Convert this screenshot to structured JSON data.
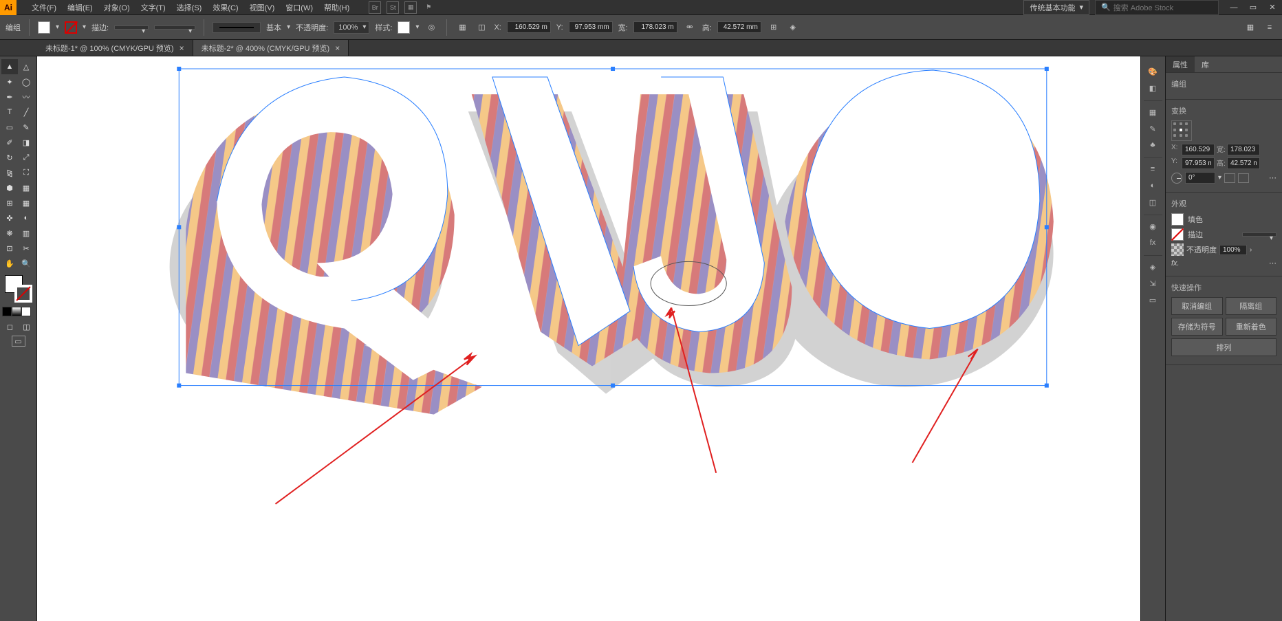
{
  "app": {
    "logo": "Ai"
  },
  "menu": {
    "file": "文件(F)",
    "edit": "编辑(E)",
    "object": "对象(O)",
    "type": "文字(T)",
    "select": "选择(S)",
    "effect": "效果(C)",
    "view": "视图(V)",
    "window": "窗口(W)",
    "help": "帮助(H)"
  },
  "workspace": "传统基本功能",
  "search_placeholder": "搜索 Adobe Stock",
  "control": {
    "selection_label": "编组",
    "stroke_label": "描边:",
    "stroke_weight": "",
    "brush_label": "基本",
    "opacity_label": "不透明度:",
    "opacity_value": "100%",
    "style_label": "样式:",
    "x_label": "X:",
    "x_value": "160.529 m",
    "y_label": "Y:",
    "y_value": "97.953 mm",
    "w_label": "宽:",
    "w_value": "178.023 m",
    "h_label": "高:",
    "h_value": "42.572 mm"
  },
  "tabs": [
    {
      "title": "未标题-1* @ 100% (CMYK/GPU 预览)",
      "active": false
    },
    {
      "title": "未标题-2* @ 400% (CMYK/GPU 预览)",
      "active": true
    }
  ],
  "properties": {
    "panel_tab_properties": "属性",
    "panel_tab_libraries": "库",
    "object_type": "编组",
    "sections": {
      "transform": "变换",
      "appearance": "外观",
      "quick_actions": "快速操作"
    },
    "transform": {
      "x": "160.529",
      "y": "97.953 m",
      "w": "178.023",
      "h": "42.572 m",
      "angle": "0°"
    },
    "appearance": {
      "fill_label": "填色",
      "stroke_label": "描边",
      "stroke_weight": "",
      "opacity_label": "不透明度",
      "opacity_value": "100%",
      "fx_label": "fx."
    },
    "actions": {
      "ungroup": "取消编组",
      "isolate": "隔离组",
      "save_symbol": "存储为符号",
      "recolor": "重新着色",
      "arrange": "排列"
    }
  }
}
